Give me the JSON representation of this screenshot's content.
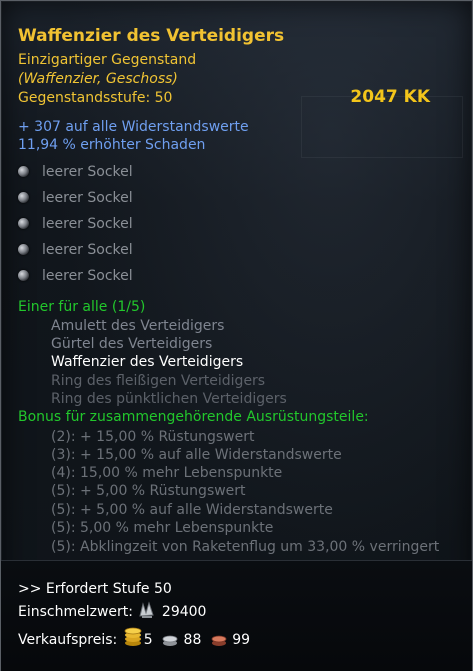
{
  "item": {
    "name": "Waffenzier des Verteidigers",
    "rarity": "Einzigartiger Gegenstand",
    "type": "(Waffenzier, Geschoss)",
    "level_label": "Gegenstandsstufe:",
    "level_value": "50",
    "price": "2047 KK"
  },
  "stats": [
    "+ 307 auf alle Widerstandswerte",
    "11,94 % erhöhter Schaden"
  ],
  "sockets": [
    "leerer Sockel",
    "leerer Sockel",
    "leerer Sockel",
    "leerer Sockel",
    "leerer Sockel"
  ],
  "set": {
    "title": "Einer für alle (1/5)",
    "items": [
      "Amulett des Verteidigers",
      "Gürtel des Verteidigers",
      "Waffenzier des Verteidigers",
      "Ring des fleißigen Verteidigers",
      "Ring des pünktlichen Verteidigers"
    ],
    "bonus_title": "Bonus für zusammengehörende Ausrüstungsteile:",
    "bonuses": [
      "(2): + 15,00 % Rüstungswert",
      "(3): + 15,00 % auf alle Widerstandswerte",
      "(4): 15,00 % mehr Lebenspunkte",
      "(5): + 5,00 % Rüstungswert",
      "(5): + 5,00 % auf alle Widerstandswerte",
      "(5): 5,00 % mehr Lebenspunkte",
      "(5): Abklingzeit von Raketenflug um 33,00 % verringert"
    ]
  },
  "footer": {
    "requirement": ">> Erfordert Stufe 50",
    "melt_label": "Einschmelzwert:",
    "melt_value": "29400",
    "sell_label": "Verkaufspreis:",
    "sell_gold": "5",
    "sell_silver": "88",
    "sell_copper": "99"
  },
  "colors": {
    "title": "#f1c232",
    "stat_blue": "#6f9ff0",
    "set_green": "#22c72c",
    "active_white": "#ffffff",
    "muted_gray": "#7f8590"
  },
  "icons": [
    "socket-empty-icon",
    "scrap-icon",
    "gold-coin-icon",
    "silver-coin-icon",
    "copper-coin-icon"
  ]
}
